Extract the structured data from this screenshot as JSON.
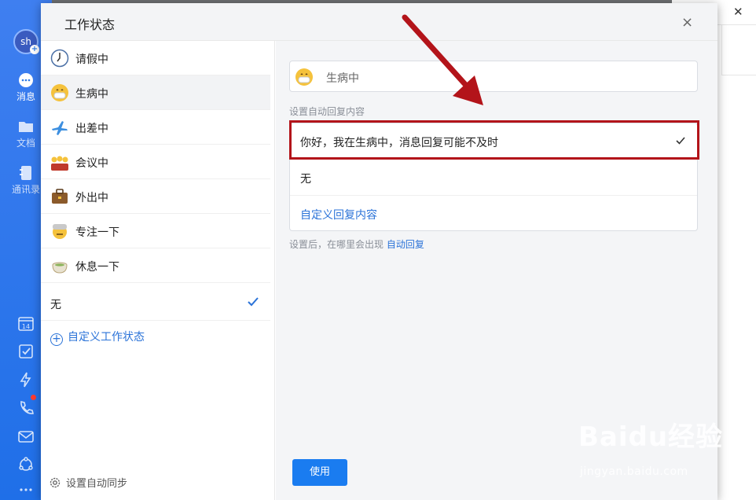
{
  "modal": {
    "title": "工作状态",
    "close": "×"
  },
  "nav": {
    "avatar_text": "sh",
    "items": [
      {
        "label": "消息"
      },
      {
        "label": "文档"
      },
      {
        "label": "通讯录"
      }
    ]
  },
  "status_list": {
    "items": [
      {
        "label": "请假中",
        "icon": "clock-icon"
      },
      {
        "label": "生病中",
        "icon": "sick-face-icon"
      },
      {
        "label": "出差中",
        "icon": "airplane-icon"
      },
      {
        "label": "会议中",
        "icon": "meeting-people-icon"
      },
      {
        "label": "外出中",
        "icon": "briefcase-icon"
      },
      {
        "label": "专注一下",
        "icon": "focus-face-icon"
      },
      {
        "label": "休息一下",
        "icon": "tea-cup-icon"
      },
      {
        "label": "无"
      }
    ],
    "custom_label": "自定义工作状态",
    "sync_label": "设置自动同步"
  },
  "status_detail": {
    "current_status": "生病中",
    "auto_reply_label": "设置自动回复内容",
    "replies": [
      {
        "text": "你好，我在生病中，消息回复可能不及时",
        "selected": true
      },
      {
        "text": "无"
      },
      {
        "text": "自定义回复内容",
        "link": true
      }
    ],
    "hint_prefix": "设置后，在哪里会出现",
    "hint_link": "自动回复",
    "use_button": "使用"
  },
  "watermark": {
    "line1": "Baidu经验",
    "line2": "jingyan.baidu.com"
  },
  "colors": {
    "nav_blue": "#2f7be5",
    "accent": "#1a7cf0",
    "annotation_red": "#b3141a"
  }
}
